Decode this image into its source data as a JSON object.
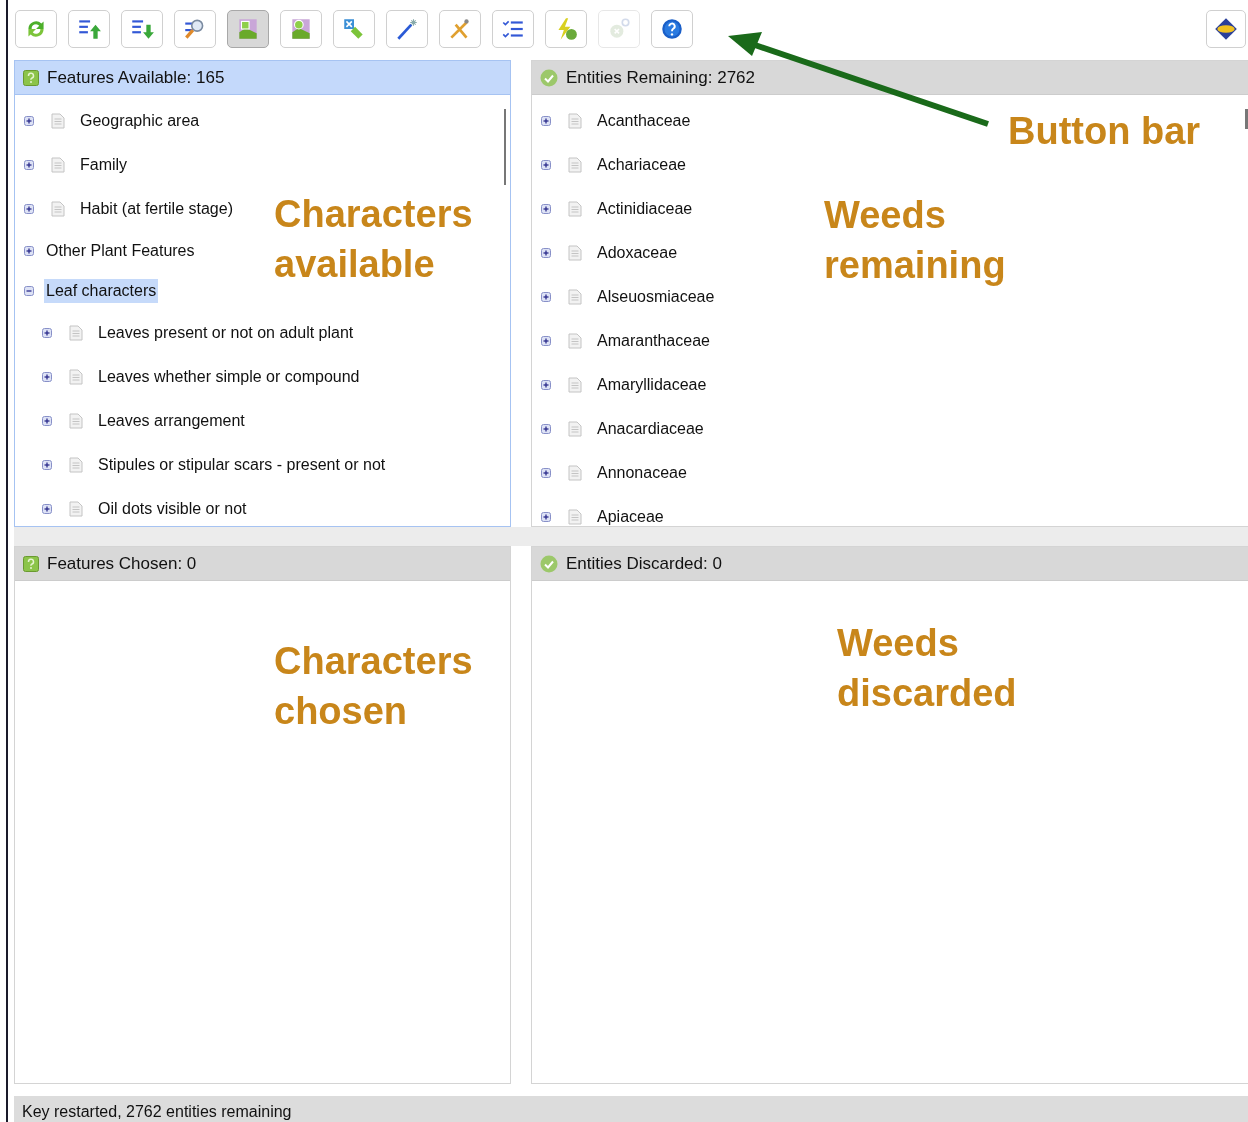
{
  "toolbar": {
    "buttons": [
      {
        "selected": false,
        "disabled": false
      },
      {
        "selected": false,
        "disabled": false
      },
      {
        "selected": false,
        "disabled": false
      },
      {
        "selected": false,
        "disabled": false
      },
      {
        "selected": true,
        "disabled": false
      },
      {
        "selected": false,
        "disabled": false
      },
      {
        "selected": false,
        "disabled": false
      },
      {
        "selected": false,
        "disabled": false
      },
      {
        "selected": false,
        "disabled": false
      },
      {
        "selected": false,
        "disabled": false
      },
      {
        "selected": false,
        "disabled": false
      },
      {
        "selected": false,
        "disabled": true
      },
      {
        "selected": false,
        "disabled": false
      }
    ]
  },
  "features_available": {
    "title": "Features Available: 165",
    "active": true,
    "items": [
      {
        "label": "Geographic area",
        "kind": "item",
        "expanded": false,
        "selected": false
      },
      {
        "label": "Family",
        "kind": "item",
        "expanded": false,
        "selected": false
      },
      {
        "label": "Habit (at fertile stage)",
        "kind": "item",
        "expanded": false,
        "selected": false
      },
      {
        "label": "Other Plant Features",
        "kind": "group",
        "expanded": false,
        "selected": false
      },
      {
        "label": "Leaf characters",
        "kind": "group",
        "expanded": true,
        "selected": true,
        "children": [
          {
            "label": "Leaves present or not on adult plant",
            "kind": "item",
            "expanded": false,
            "selected": false
          },
          {
            "label": "Leaves whether simple or compound",
            "kind": "item",
            "expanded": false,
            "selected": false
          },
          {
            "label": "Leaves arrangement",
            "kind": "item",
            "expanded": false,
            "selected": false
          },
          {
            "label": "Stipules or stipular scars - present or not",
            "kind": "item",
            "expanded": false,
            "selected": false
          },
          {
            "label": "Oil dots visible or not",
            "kind": "item",
            "expanded": false,
            "selected": false
          }
        ]
      }
    ]
  },
  "entities_remaining": {
    "title": "Entities Remaining: 2762",
    "active": false,
    "items": [
      {
        "label": "Acanthaceae",
        "kind": "item",
        "expanded": false,
        "selected": false
      },
      {
        "label": "Achariaceae",
        "kind": "item",
        "expanded": false,
        "selected": false
      },
      {
        "label": "Actinidiaceae",
        "kind": "item",
        "expanded": false,
        "selected": false
      },
      {
        "label": "Adoxaceae",
        "kind": "item",
        "expanded": false,
        "selected": false
      },
      {
        "label": "Alseuosmiaceae",
        "kind": "item",
        "expanded": false,
        "selected": false
      },
      {
        "label": "Amaranthaceae",
        "kind": "item",
        "expanded": false,
        "selected": false
      },
      {
        "label": "Amaryllidaceae",
        "kind": "item",
        "expanded": false,
        "selected": false
      },
      {
        "label": "Anacardiaceae",
        "kind": "item",
        "expanded": false,
        "selected": false
      },
      {
        "label": "Annonaceae",
        "kind": "item",
        "expanded": false,
        "selected": false
      },
      {
        "label": "Apiaceae",
        "kind": "item",
        "expanded": false,
        "selected": false
      }
    ]
  },
  "features_chosen": {
    "title": "Features Chosen: 0",
    "active": false
  },
  "entities_discarded": {
    "title": "Entities Discarded: 0",
    "active": false
  },
  "status_bar": "Key restarted, 2762 entities remaining",
  "annotations": [
    {
      "lines": [
        "Button bar"
      ]
    },
    {
      "lines": [
        "Characters",
        "available"
      ]
    },
    {
      "lines": [
        "Weeds",
        "remaining"
      ]
    },
    {
      "lines": [
        "Characters",
        "chosen"
      ]
    },
    {
      "lines": [
        "Weeds",
        "discarded"
      ]
    }
  ]
}
